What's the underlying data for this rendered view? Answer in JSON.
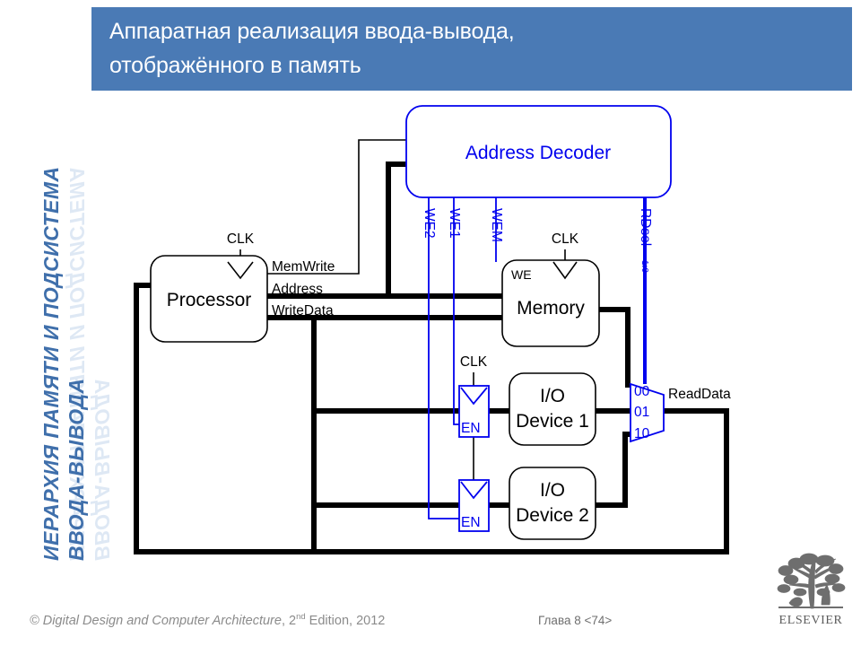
{
  "slide": {
    "title_lines": [
      "Аппаратная реализация ввода-вывода,",
      "отображённого в память"
    ],
    "title_bar_color": "#4a7ab5",
    "background_color": "#ffffff"
  },
  "sidebar": {
    "line1": "ИЕРАРХИЯ ПАМЯТИ И ПОДСИСТЕМА",
    "line2": "ВВОДА-ВЫВОДА",
    "text_color": "#3f6fab"
  },
  "footer": {
    "copyright_prefix": "© ",
    "copyright_title": "Digital Design and Computer Architecture",
    "copyright_edition_pre": ", 2",
    "copyright_edition_sup": "nd",
    "copyright_edition_post": " Edition, 2012",
    "chapter": "Глава 8 <74>",
    "logo_word": "ELSEVIER"
  },
  "diagram": {
    "accent_blue": "#0000ee",
    "wire_black": "#000000",
    "blocks": [
      {
        "id": "address-decoder",
        "label": "Address Decoder",
        "color": "blue"
      },
      {
        "id": "processor",
        "label": "Processor",
        "color": "black"
      },
      {
        "id": "memory",
        "label": "Memory",
        "color": "black",
        "port_label": "WE"
      },
      {
        "id": "io-device-1",
        "label_line1": "I/O",
        "label_line2": "Device 1",
        "color": "black"
      },
      {
        "id": "io-device-2",
        "label_line1": "I/O",
        "label_line2": "Device 2",
        "color": "black"
      }
    ],
    "registers": [
      {
        "id": "en-register-1",
        "label": "EN",
        "clock_label": "CLK"
      },
      {
        "id": "en-register-2",
        "label": "EN"
      }
    ],
    "mux": {
      "id": "readdata-mux",
      "inputs": [
        "00",
        "01",
        "10"
      ],
      "select_label": "RDsel",
      "select_subscript": "1:0",
      "output_label": "ReadData"
    },
    "wire_labels": {
      "processor_clk": "CLK",
      "memwrite": "MemWrite",
      "address": "Address",
      "writedata": "WriteData",
      "memory_clk": "CLK",
      "we2": "WE2",
      "we1": "WE1",
      "wem": "WEM",
      "memory_we_port": "WE",
      "readdata": "ReadData"
    }
  }
}
